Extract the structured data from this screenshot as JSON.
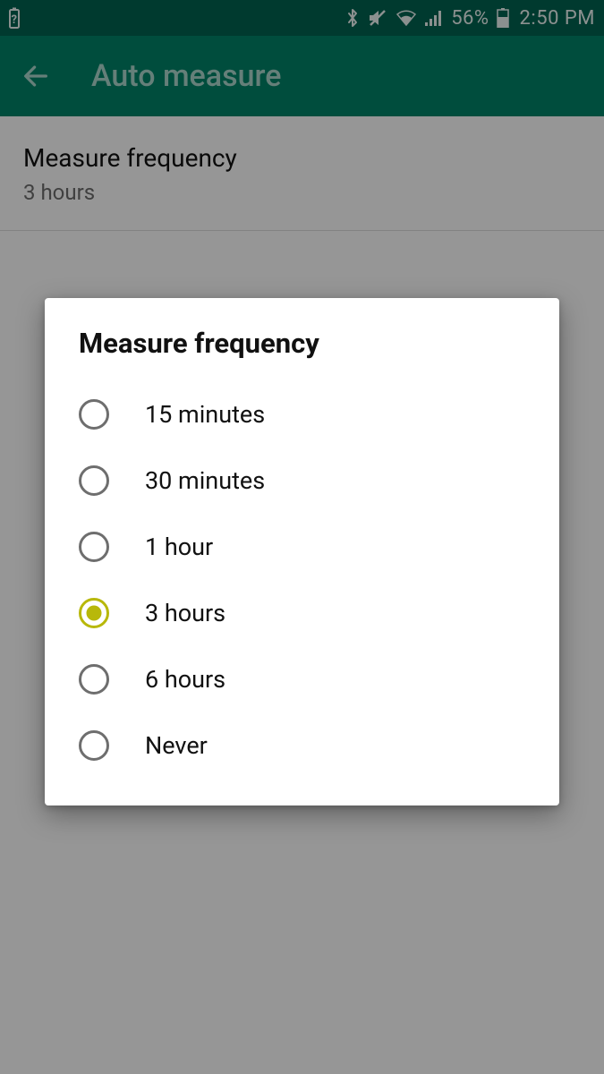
{
  "status_bar": {
    "battery_unknown_icon": "battery-unknown",
    "bluetooth_icon": "bluetooth",
    "mute_icon": "mute",
    "wifi_icon": "wifi",
    "signal_icon": "signal",
    "battery_pct": "56%",
    "battery_icon": "battery",
    "clock": "2:50 PM"
  },
  "app_bar": {
    "back_icon": "back-arrow",
    "title": "Auto measure"
  },
  "content": {
    "setting_title": "Measure frequency",
    "setting_value": "3 hours"
  },
  "dialog": {
    "title": "Measure frequency",
    "selected_index": 3,
    "options": [
      {
        "label": "15 minutes"
      },
      {
        "label": "30 minutes"
      },
      {
        "label": "1 hour"
      },
      {
        "label": "3 hours"
      },
      {
        "label": "6 hours"
      },
      {
        "label": "Never"
      }
    ]
  }
}
